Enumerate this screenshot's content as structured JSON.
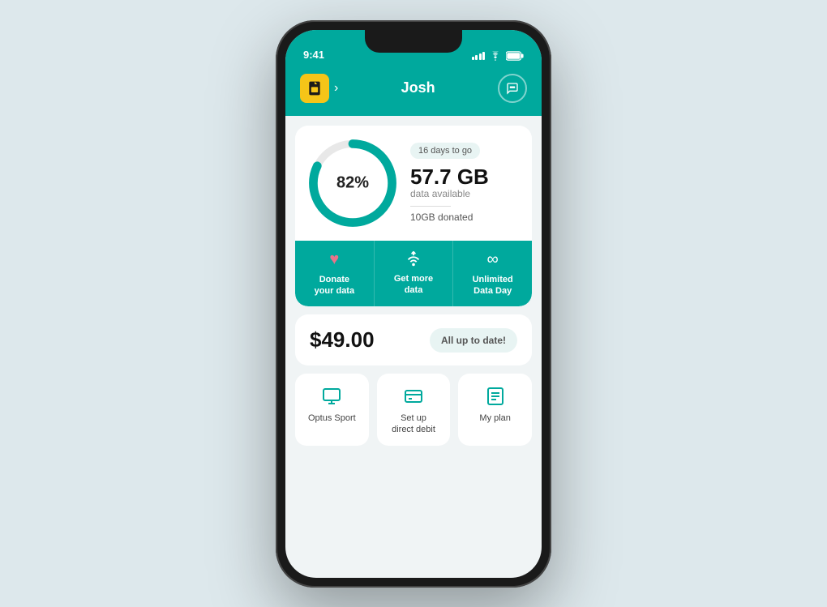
{
  "status_bar": {
    "time": "9:41"
  },
  "header": {
    "user_name": "Josh",
    "sim_icon": "📱",
    "chevron": "›"
  },
  "data_widget": {
    "percentage": "82%",
    "days_badge": "16 days to go",
    "data_amount": "57.7 GB",
    "data_available_label": "data available",
    "donated_text": "10GB donated",
    "donut_percent": 82,
    "donut_color": "#00a99d",
    "donut_bg": "#e0e0e0"
  },
  "actions": [
    {
      "id": "donate",
      "icon": "♥",
      "label": "Donate\nyour data",
      "icon_color": "#e8748a"
    },
    {
      "id": "get-more",
      "icon": "◎",
      "label": "Get more\ndata",
      "icon_color": "white"
    },
    {
      "id": "unlimited",
      "icon": "∞",
      "label": "Unlimited\nData Day",
      "icon_color": "white"
    }
  ],
  "billing": {
    "amount": "$49.00",
    "status": "All up to date!"
  },
  "services": [
    {
      "id": "optus-sport",
      "icon": "🖥",
      "label": "Optus Sport"
    },
    {
      "id": "direct-debit",
      "icon": "💳",
      "label": "Set up\ndirect debit"
    },
    {
      "id": "my-plan",
      "icon": "📋",
      "label": "My plan"
    }
  ]
}
